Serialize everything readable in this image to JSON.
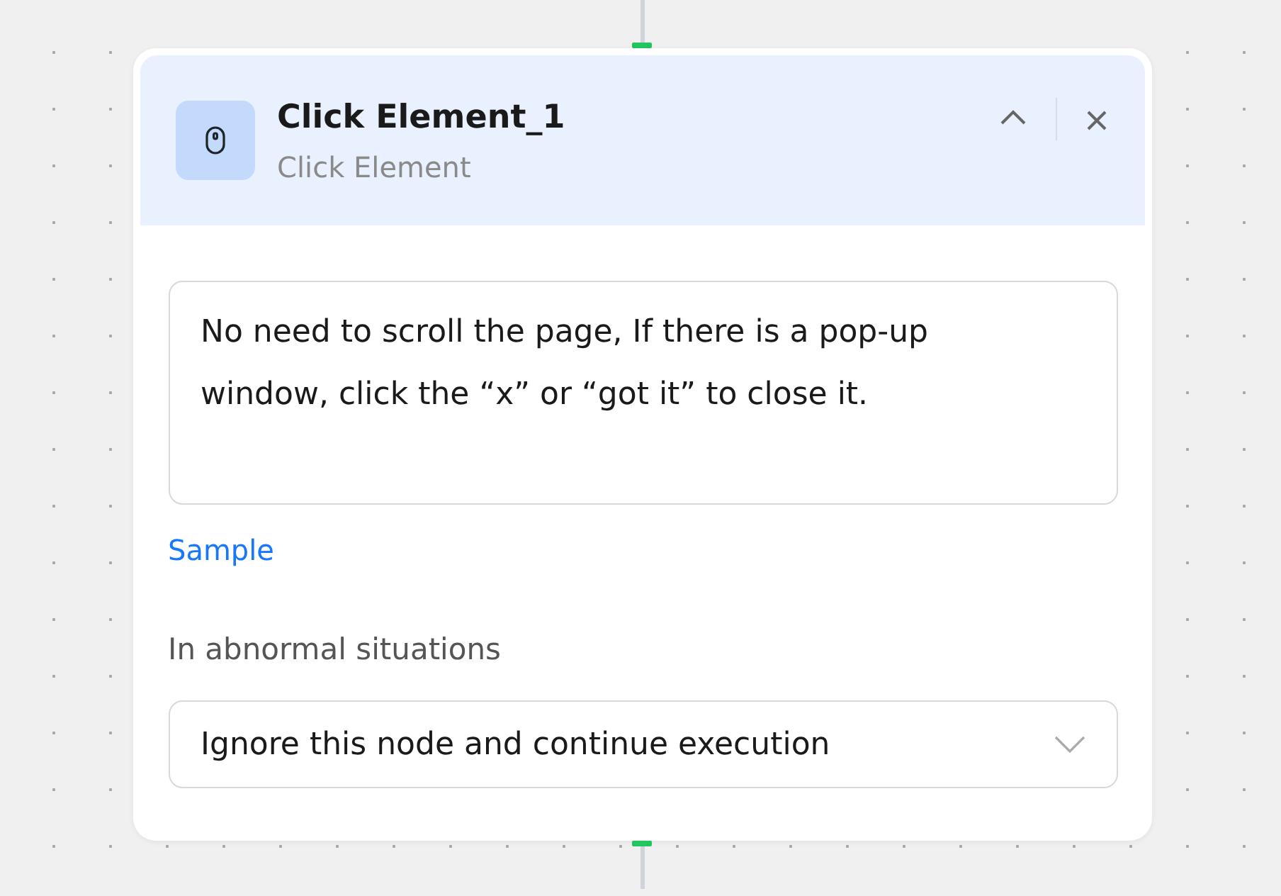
{
  "node": {
    "title": "Click Element_1",
    "subtitle": "Click Element"
  },
  "instruction": {
    "value": "No need to scroll the page, If there is a pop-up window, click the “x” or “got it” to close it."
  },
  "sample_link": "Sample",
  "abnormal": {
    "label": "In abnormal situations",
    "value": "Ignore this node and continue execution"
  }
}
